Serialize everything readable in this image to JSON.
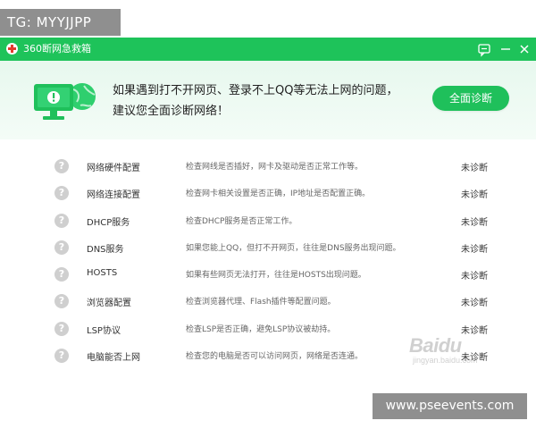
{
  "watermark_tag": "TG: MYYJJPP",
  "url_tag": "www.pseevents.com",
  "window": {
    "title": "360断网急救箱",
    "accent": "#1ec35a"
  },
  "banner": {
    "line1": "如果遇到打不开网页、登录不上QQ等无法上网的问题，",
    "line2": "建议您全面诊断网络！",
    "scan_button": "全面诊断"
  },
  "items": [
    {
      "name": "网络硬件配置",
      "desc": "检查网线是否插好，网卡及驱动是否正常工作等。",
      "status": "未诊断"
    },
    {
      "name": "网络连接配置",
      "desc": "检查网卡相关设置是否正确，IP地址是否配置正确。",
      "status": "未诊断"
    },
    {
      "name": "DHCP服务",
      "desc": "检查DHCP服务是否正常工作。",
      "status": "未诊断"
    },
    {
      "name": "DNS服务",
      "desc": "如果您能上QQ，但打不开网页，往往是DNS服务出现问题。",
      "status": "未诊断"
    },
    {
      "name": "HOSTS",
      "desc": "如果有些网页无法打开，往往是HOSTS出现问题。",
      "status": "未诊断"
    },
    {
      "name": "浏览器配置",
      "desc": "检查浏览器代理、Flash插件等配置问题。",
      "status": "未诊断"
    },
    {
      "name": "LSP协议",
      "desc": "检查LSP是否正确，避免LSP协议被劫持。",
      "status": "未诊断"
    },
    {
      "name": "电脑能否上网",
      "desc": "检查您的电脑是否可以访问网页，网络是否连通。",
      "status": "未诊断"
    }
  ],
  "baidu_watermark": {
    "brand": "Baidu",
    "sub": "jingyan.baidu.com"
  }
}
